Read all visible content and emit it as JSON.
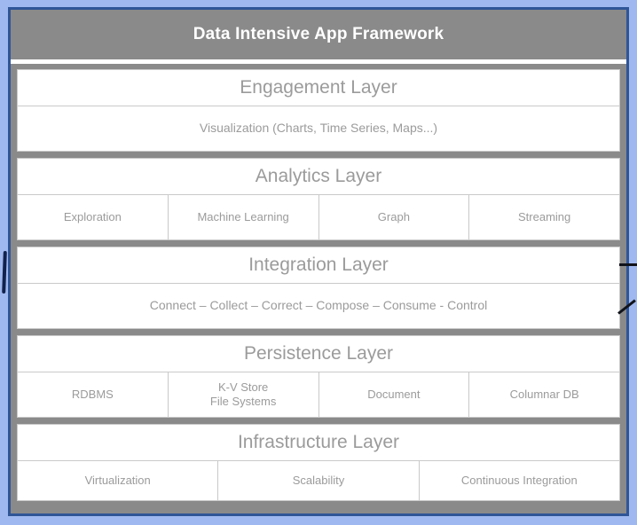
{
  "header": {
    "title": "Data Intensive App Framework"
  },
  "colors": {
    "frame_outer": "#9fb8ef",
    "frame_inner": "#2f5597",
    "header_bg": "#8a8a8a",
    "header_text": "#ffffff",
    "panel_bg": "#ffffff",
    "panel_border": "#c9c9c9",
    "layer_text": "#9b9b9b"
  },
  "layers": [
    {
      "title": "Engagement Layer",
      "cells": [
        "Visualization (Charts, Time Series, Maps...)"
      ]
    },
    {
      "title": "Analytics Layer",
      "cells": [
        "Exploration",
        "Machine Learning",
        "Graph",
        "Streaming"
      ]
    },
    {
      "title": "Integration Layer",
      "cells": [
        "Connect – Collect – Correct – Compose – Consume - Control"
      ]
    },
    {
      "title": "Persistence Layer",
      "cells": [
        "RDBMS",
        "K-V Store\nFile Systems",
        "Document",
        "Columnar DB"
      ]
    },
    {
      "title": "Infrastructure Layer",
      "cells": [
        "Virtualization",
        "Scalability",
        "Continuous Integration"
      ]
    }
  ],
  "annotations": {
    "left_mark": "ink-vertical-stroke",
    "right_mark": "ink-horizontal-stroke",
    "right_slash": "ink-diagonal-stroke"
  }
}
